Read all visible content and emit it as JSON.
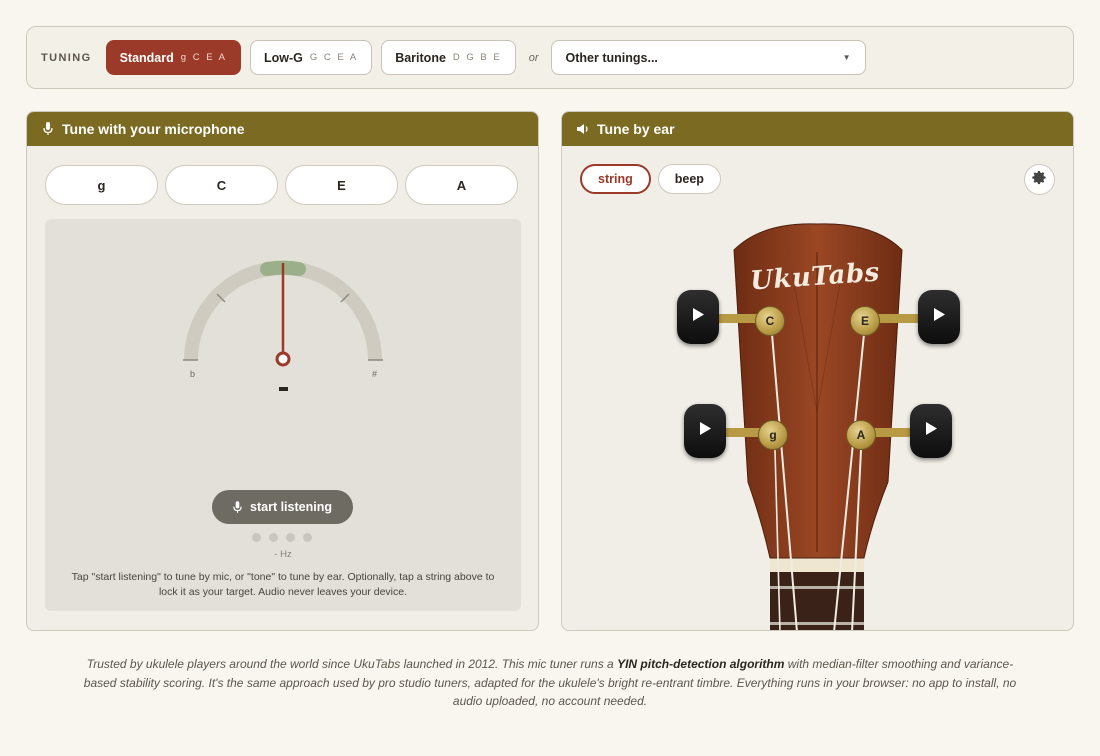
{
  "tuning": {
    "label": "TUNING",
    "options": [
      {
        "name": "Standard",
        "notes": "g C E A",
        "active": true
      },
      {
        "name": "Low-G",
        "notes": "G C E A",
        "active": false
      },
      {
        "name": "Baritone",
        "notes": "D G B E",
        "active": false
      }
    ],
    "or": "or",
    "select_value": "Other tunings..."
  },
  "mic_panel": {
    "title": "Tune with your microphone",
    "strings": [
      "g",
      "C",
      "E",
      "A"
    ],
    "flat": "b",
    "sharp": "#",
    "listen_label": "start listening",
    "hz": "- Hz",
    "hint": "Tap \"start listening\" to tune by mic, or \"tone\" to tune by ear. Optionally, tap a string above to lock it as your target. Audio never leaves your device."
  },
  "ear_panel": {
    "title": "Tune by ear",
    "modes": [
      {
        "label": "string",
        "active": true
      },
      {
        "label": "beep",
        "active": false
      }
    ],
    "brand": "UkuTabs",
    "pegs": {
      "top_left": "C",
      "top_right": "E",
      "bottom_left": "g",
      "bottom_right": "A"
    }
  },
  "footer": {
    "before": "Trusted by ukulele players around the world since UkuTabs launched in 2012. This mic tuner runs a ",
    "bold": "YIN pitch-detection algorithm",
    "after": " with median-filter smoothing and variance-based stability scoring. It's the same approach used by pro studio tuners, adapted for the ukulele's bright re-entrant timbre. Everything runs in your browser: no app to install, no audio uploaded, no account needed."
  },
  "colors": {
    "accent": "#9b3a28",
    "header": "#7a6a22",
    "wood": "#8a3f1f"
  }
}
